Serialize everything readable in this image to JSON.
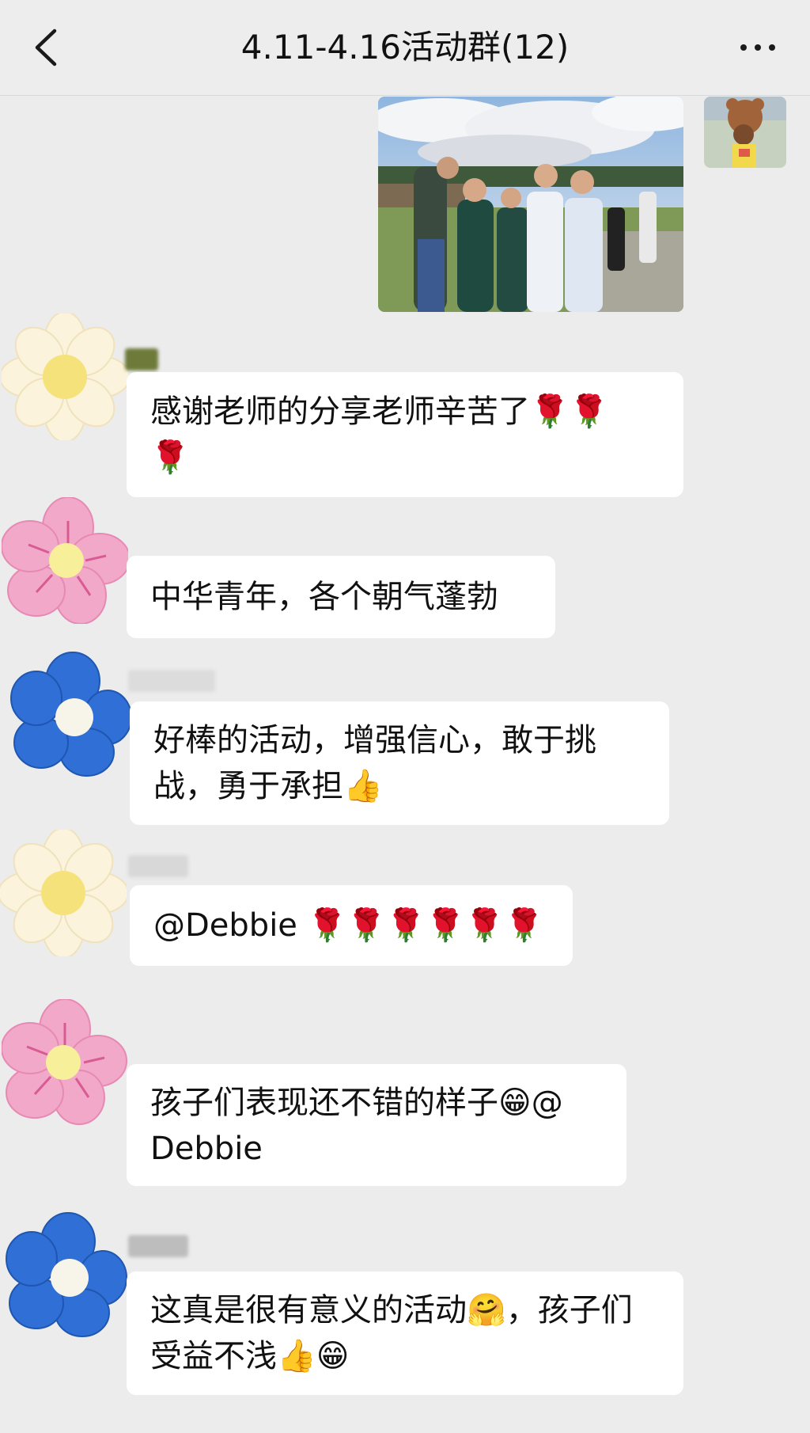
{
  "header": {
    "title": "4.11-4.16活动群(12)"
  },
  "messages": [
    {
      "lines": [
        "感谢老师的分享老师辛苦了🌹🌹",
        "🌹"
      ]
    },
    {
      "lines": [
        "中华青年，各个朝气蓬勃"
      ]
    },
    {
      "lines": [
        "好棒的活动，增强信心，敢于挑",
        "战，勇于承担👍"
      ]
    },
    {
      "lines": [
        "@Debbie 🌹🌹🌹🌹🌹🌹"
      ]
    },
    {
      "lines": [
        "孩子们表现还不错的样子😁@",
        "Debbie"
      ]
    },
    {
      "lines": [
        "这真是很有意义的活动🤗，孩子们",
        "受益不浅👍😁"
      ]
    }
  ],
  "icons": {
    "back": "chevron-left-icon",
    "more": "more-dots-icon"
  },
  "colors": {
    "background": "#ececec",
    "bubble": "#ffffff",
    "flower_white": "#fbf3dc",
    "flower_pink": "#f2a8c8",
    "flower_blue": "#2f6fd6",
    "flower_center_yellow": "#f5e27a",
    "flower_center_white": "#f7f4ea"
  }
}
